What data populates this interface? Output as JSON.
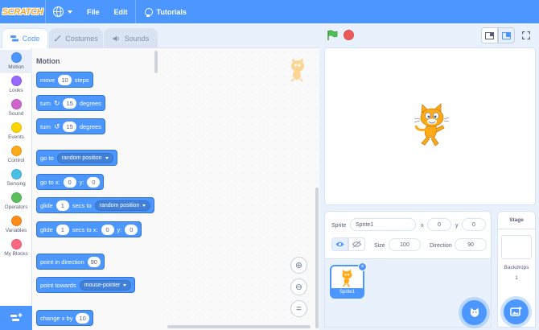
{
  "menubar": {
    "logo_text": "SCRATCH",
    "file": "File",
    "edit": "Edit",
    "tutorials": "Tutorials"
  },
  "tabs": {
    "code": "Code",
    "costumes": "Costumes",
    "sounds": "Sounds"
  },
  "categories": [
    {
      "label": "Motion",
      "color": "#4c97ff"
    },
    {
      "label": "Looks",
      "color": "#9966ff"
    },
    {
      "label": "Sound",
      "color": "#cf63cf"
    },
    {
      "label": "Events",
      "color": "#ffd500"
    },
    {
      "label": "Control",
      "color": "#ffab19"
    },
    {
      "label": "Sensing",
      "color": "#4cbfe6"
    },
    {
      "label": "Operators",
      "color": "#59c059"
    },
    {
      "label": "Variables",
      "color": "#ff8c1a"
    },
    {
      "label": "My Blocks",
      "color": "#ff6680"
    }
  ],
  "flyout": {
    "title": "Motion",
    "blocks": {
      "move": {
        "pre": "move",
        "val": "10",
        "post": "steps"
      },
      "turn_right": {
        "pre": "turn",
        "val": "15",
        "post": "degrees"
      },
      "turn_left": {
        "pre": "turn",
        "val": "15",
        "post": "degrees"
      },
      "goto": {
        "pre": "go to",
        "option": "random position"
      },
      "goto_xy": {
        "pre": "go to x:",
        "x": "0",
        "ylabel": "y:",
        "y": "0"
      },
      "glide_to": {
        "pre": "glide",
        "val": "1",
        "mid": "secs to",
        "option": "random position"
      },
      "glide_xy": {
        "pre": "glide",
        "val": "1",
        "mid": "secs to x:",
        "x": "0",
        "ylabel": "y:",
        "y": "0"
      },
      "point_dir": {
        "pre": "point in direction",
        "val": "90"
      },
      "point_towards": {
        "pre": "point towards",
        "option": "mouse-pointer"
      },
      "change_x": {
        "pre": "change x by",
        "val": "10"
      }
    }
  },
  "sprite_info": {
    "sprite_label": "Sprite",
    "sprite_name": "Sprite1",
    "x_label": "x",
    "x": "0",
    "y_label": "y",
    "y": "0",
    "size_label": "Size",
    "size": "100",
    "direction_label": "Direction",
    "direction": "90"
  },
  "sprites": [
    {
      "name": "Sprite1"
    }
  ],
  "stage_panel": {
    "title": "Stage",
    "backdrops_label": "Backdrops",
    "backdrops_count": "1"
  },
  "colors": {
    "accent": "#4c97ff",
    "motion_block": "#4c97ff",
    "stop": "#ec5959",
    "flag": "#4cbf56"
  },
  "icons": [
    "globe-icon",
    "bulb-icon",
    "green-flag-icon",
    "stop-icon",
    "zoom-in-icon",
    "zoom-out-icon",
    "zoom-reset-icon"
  ]
}
